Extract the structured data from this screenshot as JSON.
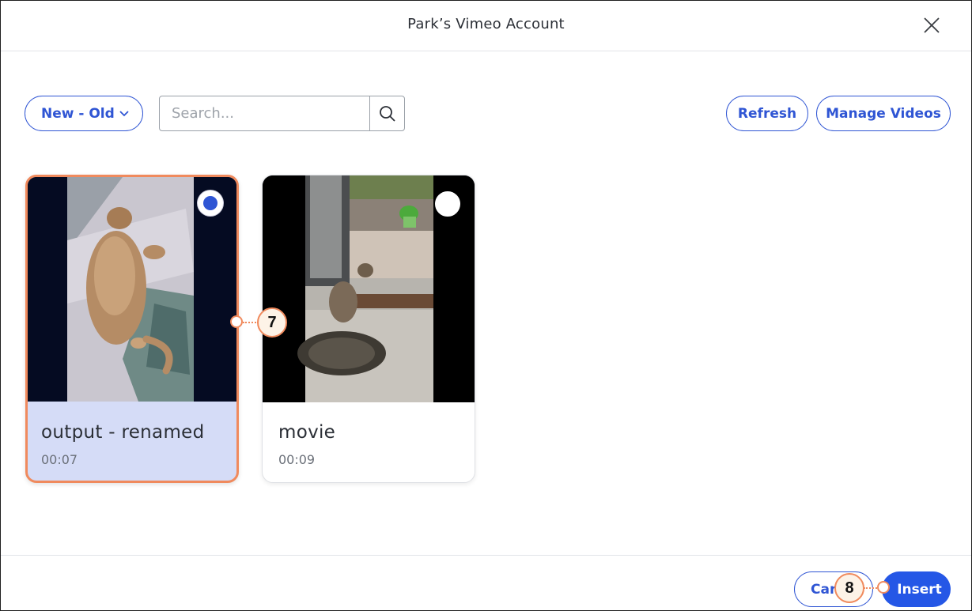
{
  "header": {
    "title": "Park’s Vimeo Account"
  },
  "toolbar": {
    "sort_label": "New - Old",
    "search_placeholder": "Search...",
    "search_value": "",
    "refresh_label": "Refresh",
    "manage_label": "Manage Videos"
  },
  "videos": [
    {
      "title": "output - renamed",
      "duration": "00:07",
      "selected": true
    },
    {
      "title": "movie",
      "duration": "00:09",
      "selected": false
    }
  ],
  "footer": {
    "cancel_label": "Car",
    "insert_label": "Insert"
  },
  "callouts": [
    {
      "number": "7"
    },
    {
      "number": "8"
    }
  ],
  "colors": {
    "accent": "#2f55d4",
    "insert_bg": "#2557e6",
    "selection_border": "#f08a5d",
    "selected_card_bg": "#d5dcf7"
  },
  "icons": {
    "close": "close-icon",
    "search": "search-icon",
    "chevron": "chevron-down-icon"
  }
}
